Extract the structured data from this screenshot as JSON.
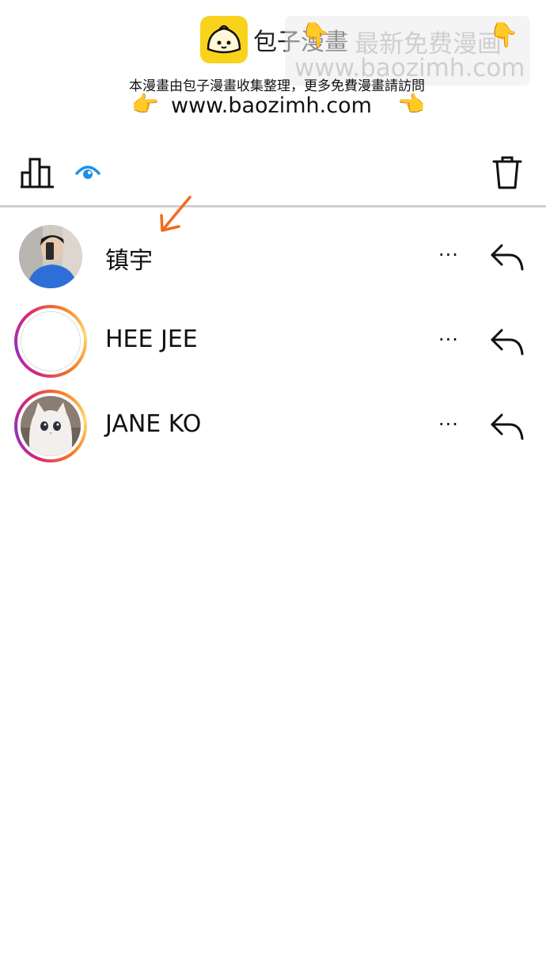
{
  "watermark": {
    "brand": "包子漫畫",
    "overlay_title": "最新免费漫画",
    "overlay_url": "www.baozimh.com",
    "notice": "本漫畫由包子漫畫收集整理，更多免費漫畫請訪問",
    "url": "www.baozimh.com",
    "colors": {
      "logo_bg": "#f9d21c"
    }
  },
  "toolbar": {
    "stats_icon": "bar-chart-icon",
    "view_icon": "eye-icon",
    "delete_icon": "trash-icon",
    "accent": "#1e90e8"
  },
  "viewers": [
    {
      "name": "镇宇",
      "avatar": "photo-man-blue-shirt",
      "story_ring": false
    },
    {
      "name": "HEE JEE",
      "avatar": "blank-white",
      "story_ring": true
    },
    {
      "name": "JANE KO",
      "avatar": "photo-white-cat",
      "story_ring": true
    }
  ],
  "row_actions": {
    "more_label": "···",
    "reply_icon": "reply-arrow-icon"
  },
  "annotation": {
    "arrow_color": "#f26b1d",
    "arrow_icon": "hand-drawn-arrow-icon"
  }
}
